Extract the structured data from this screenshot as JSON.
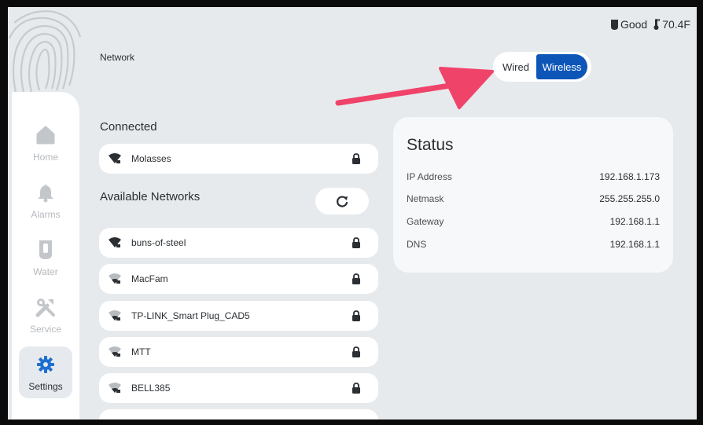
{
  "header": {
    "page_title": "Network",
    "water_status": "Good",
    "temperature": "70.4F"
  },
  "connection_toggle": {
    "wired_label": "Wired",
    "wireless_label": "Wireless",
    "selected": "Wireless"
  },
  "sidebar": {
    "items": [
      {
        "label": "Home",
        "icon": "home-icon"
      },
      {
        "label": "Alarms",
        "icon": "bell-icon"
      },
      {
        "label": "Water",
        "icon": "water-tube-icon"
      },
      {
        "label": "Service",
        "icon": "tools-icon"
      },
      {
        "label": "Settings",
        "icon": "gear-icon",
        "active": true
      }
    ]
  },
  "connected": {
    "heading": "Connected",
    "network": {
      "name": "Molasses",
      "secured": true
    }
  },
  "available": {
    "heading": "Available Networks",
    "networks": [
      {
        "name": "buns-of-steel",
        "secured": true
      },
      {
        "name": "MacFam",
        "secured": true
      },
      {
        "name": "TP-LINK_Smart Plug_CAD5",
        "secured": true
      },
      {
        "name": "MTT",
        "secured": true
      },
      {
        "name": "BELL385",
        "secured": true
      }
    ]
  },
  "status": {
    "title": "Status",
    "rows": [
      {
        "key": "IP Address",
        "value": "192.168.1.173"
      },
      {
        "key": "Netmask",
        "value": "255.255.255.0"
      },
      {
        "key": "Gateway",
        "value": "192.168.1.1"
      },
      {
        "key": "DNS",
        "value": "192.168.1.1"
      }
    ]
  },
  "colors": {
    "accent": "#0d56b8",
    "arrow": "#f0436a",
    "background": "#e7eaed"
  }
}
